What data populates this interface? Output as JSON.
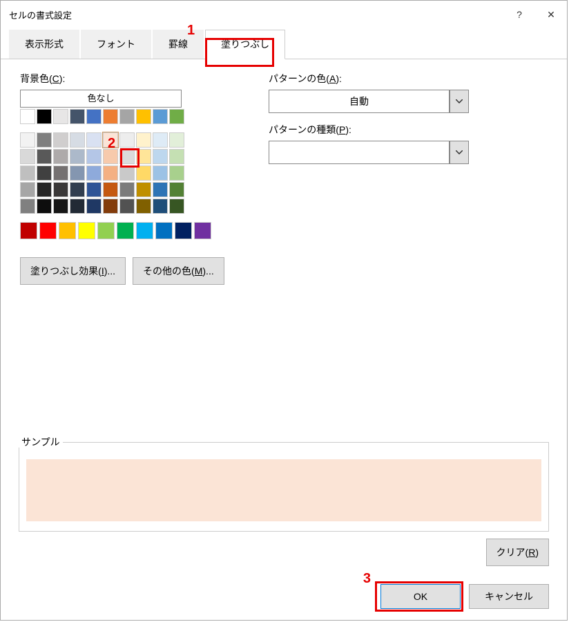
{
  "window": {
    "title": "セルの書式設定"
  },
  "titlebar": {
    "help": "?",
    "close": "✕"
  },
  "tabs": {
    "display": "表示形式",
    "font": "フォント",
    "border": "罫線",
    "fill": "塗りつぶし"
  },
  "annotations": {
    "n1": "1",
    "n2": "2",
    "n3": "3"
  },
  "fill": {
    "bg_label_pre": "背景色(",
    "bg_label_key": "C",
    "bg_label_post": "):",
    "no_color": "色なし",
    "effects_pre": "塗りつぶし効果(",
    "effects_key": "I",
    "effects_post": ")...",
    "more_pre": "その他の色(",
    "more_key": "M",
    "more_post": ")...",
    "pattern_color_pre": "パターンの色(",
    "pattern_color_key": "A",
    "pattern_color_post": "):",
    "pattern_color_value": "自動",
    "pattern_type_pre": "パターンの種類(",
    "pattern_type_key": "P",
    "pattern_type_post": "):",
    "sample_label": "サンプル",
    "clear_pre": "クリア(",
    "clear_key": "R",
    "clear_post": ")"
  },
  "buttons": {
    "ok": "OK",
    "cancel": "キャンセル"
  },
  "colors": {
    "theme_row": [
      "#ffffff",
      "#000000",
      "#e7e6e6",
      "#44546a",
      "#4472c4",
      "#ed7d31",
      "#a5a5a5",
      "#ffc000",
      "#5b9bd5",
      "#70ad47"
    ],
    "tints": [
      [
        "#f2f2f2",
        "#7f7f7f",
        "#d0cece",
        "#d6dce4",
        "#d9e1f2",
        "#fbe4d6",
        "#ededed",
        "#fff2cc",
        "#deebf6",
        "#e2efd9"
      ],
      [
        "#d9d9d9",
        "#595959",
        "#aeaaaa",
        "#acb9ca",
        "#b4c6e7",
        "#f7caac",
        "#dbdbdb",
        "#ffe599",
        "#bdd7ee",
        "#c5e0b3"
      ],
      [
        "#bfbfbf",
        "#404040",
        "#757171",
        "#8496b0",
        "#8eaadb",
        "#f4b083",
        "#c9c9c9",
        "#ffd966",
        "#9cc2e5",
        "#a8d08d"
      ],
      [
        "#a6a6a6",
        "#262626",
        "#3a3838",
        "#323e4f",
        "#2f5496",
        "#c45911",
        "#7b7b7b",
        "#bf8f00",
        "#2e74b5",
        "#538135"
      ],
      [
        "#808080",
        "#0d0d0d",
        "#161616",
        "#222a35",
        "#1f3864",
        "#833c0b",
        "#525252",
        "#806000",
        "#1f4e79",
        "#375623"
      ]
    ],
    "standard": [
      "#c00000",
      "#ff0000",
      "#ffc000",
      "#ffff00",
      "#92d050",
      "#00b050",
      "#00b0f0",
      "#0070c0",
      "#002060",
      "#7030a0"
    ]
  }
}
